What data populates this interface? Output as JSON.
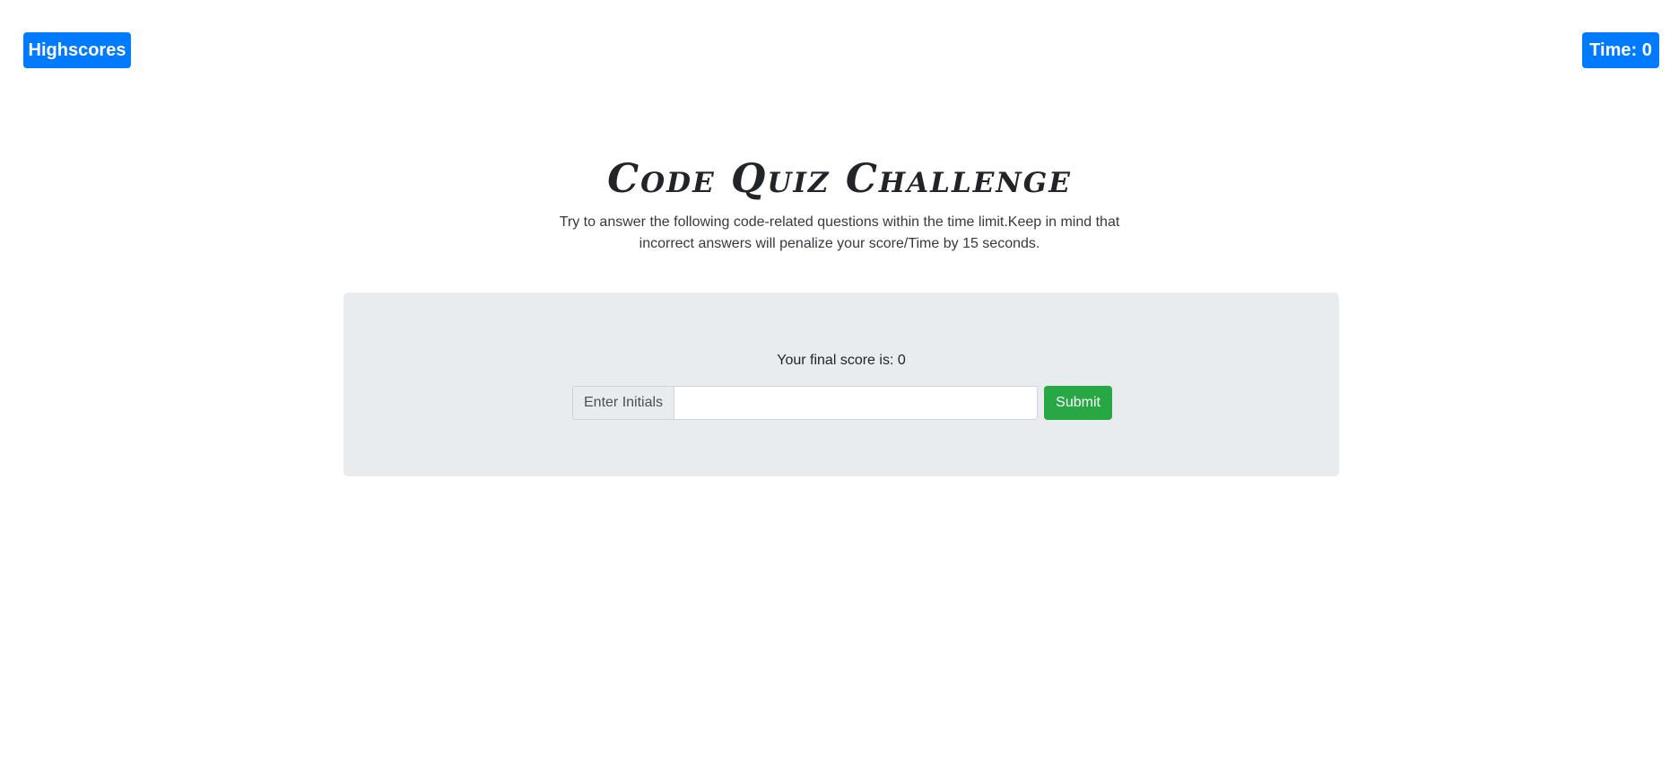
{
  "header": {
    "highscores_label": "Highscores",
    "time_label": "Time: 0"
  },
  "hero": {
    "title": "Code Quiz Challenge",
    "subtitle": "Try to answer the following code-related questions within the time limit.Keep in mind that incorrect answers will penalize your score/Time by 15 seconds."
  },
  "result_card": {
    "final_score_text": "Your final score is: 0",
    "initials_label": "Enter Initials",
    "initials_value": "",
    "initials_placeholder": "",
    "submit_label": "Submit"
  },
  "colors": {
    "primary": "#007bff",
    "success": "#28a745",
    "card_bg": "#e9ecef"
  }
}
